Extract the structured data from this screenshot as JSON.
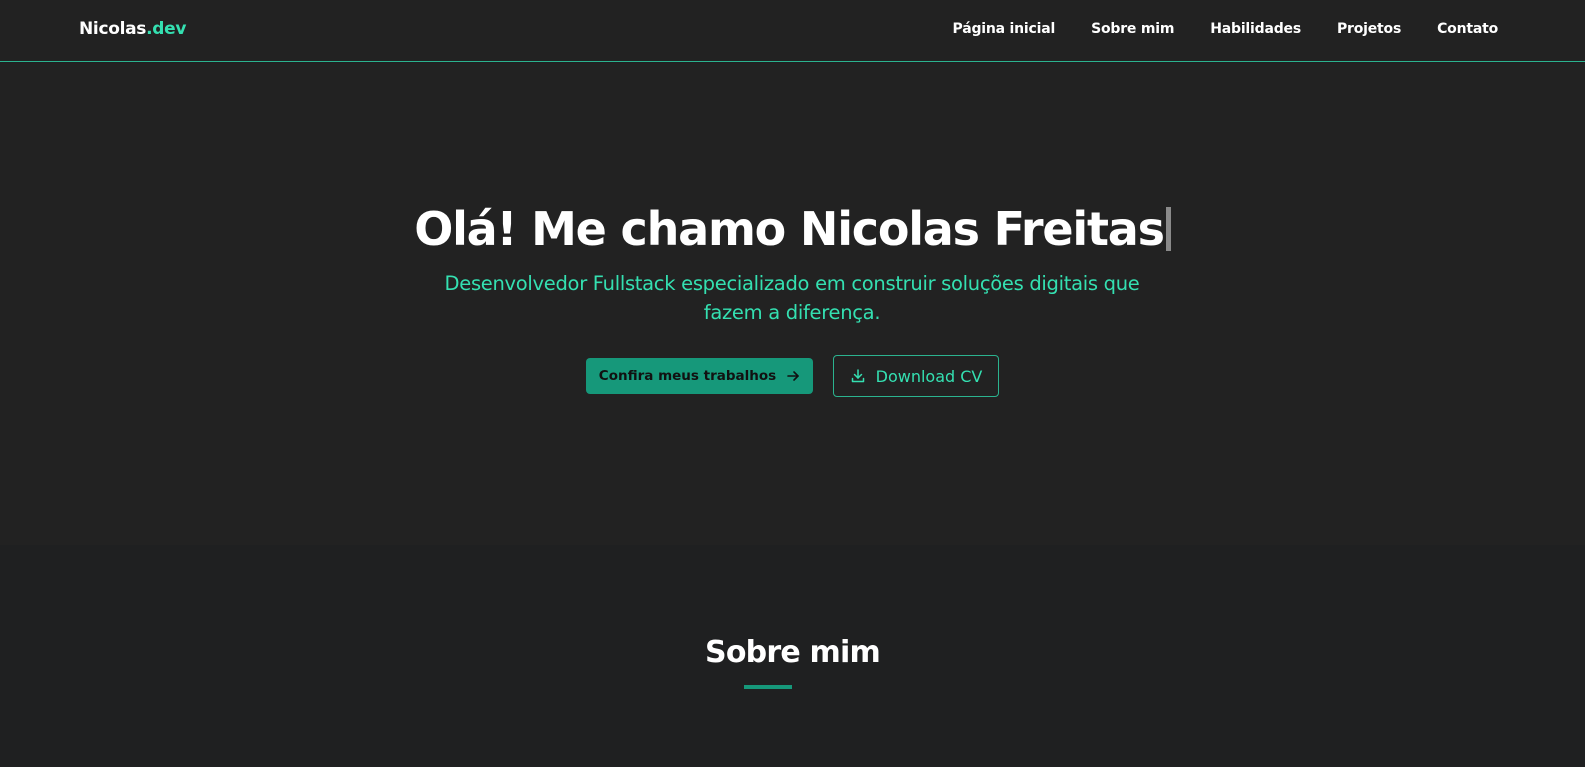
{
  "brand": {
    "name": "Nicolas",
    "suffix": ".dev"
  },
  "nav": {
    "items": [
      {
        "label": "Página inicial"
      },
      {
        "label": "Sobre mim"
      },
      {
        "label": "Habilidades"
      },
      {
        "label": "Projetos"
      },
      {
        "label": "Contato"
      }
    ]
  },
  "hero": {
    "title": "Olá! Me chamo Nicolas Freitas",
    "subtitle": "Desenvolvedor Fullstack especializado em construir soluções digitais que fazem a diferença.",
    "primary_button": {
      "label": "Confira meus trabalhos",
      "icon": "arrow-right-icon"
    },
    "secondary_button": {
      "label": "Download CV",
      "icon": "download-icon"
    }
  },
  "about": {
    "title": "Sobre mim"
  },
  "colors": {
    "accent": "#34e0b1",
    "accent_dark": "#16987a",
    "background": "#222222",
    "background_alt": "#1f2021"
  }
}
